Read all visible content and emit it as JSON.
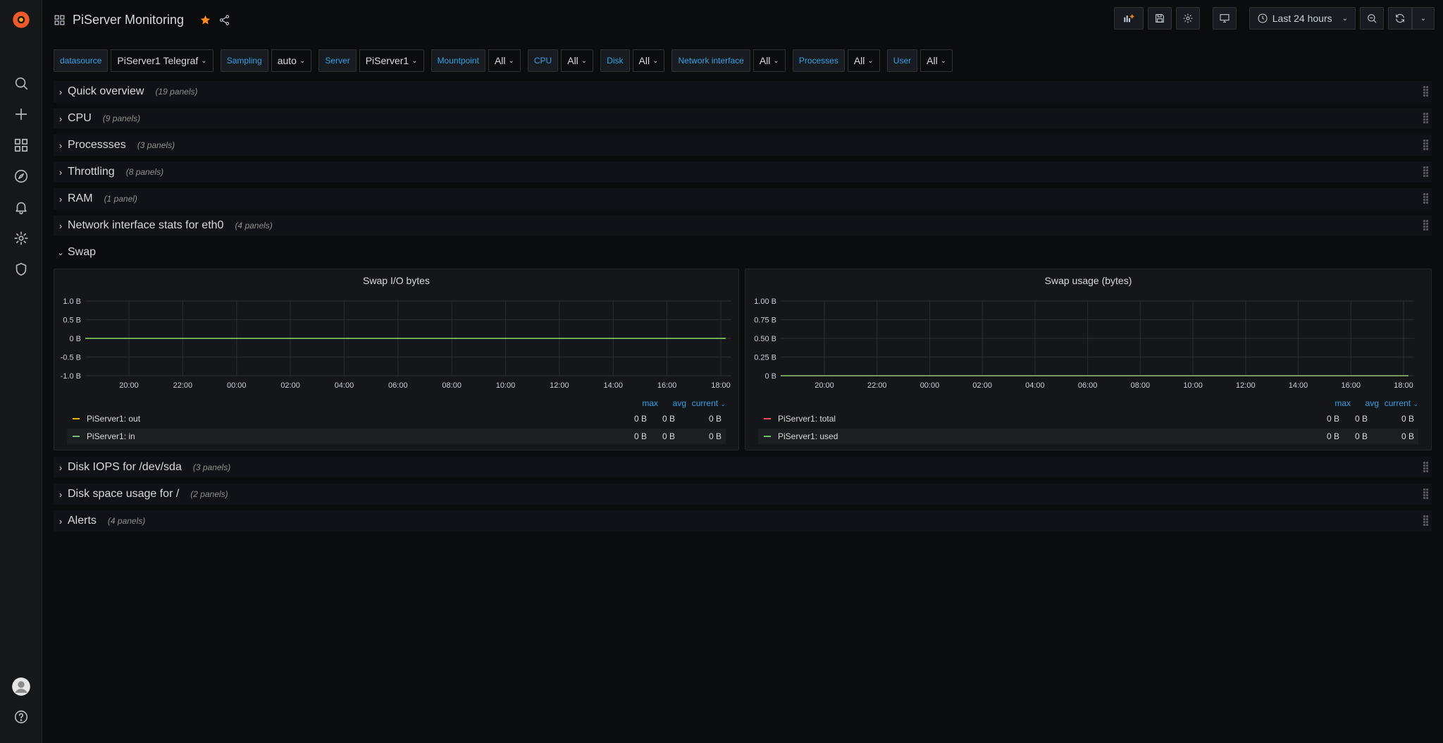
{
  "app": {
    "title": "PiServer Monitoring"
  },
  "toolbar": {
    "time_range": "Last 24 hours"
  },
  "variables": [
    {
      "label": "datasource",
      "value": "PiServer1 Telegraf"
    },
    {
      "label": "Sampling",
      "value": "auto"
    },
    {
      "label": "Server",
      "value": "PiServer1"
    },
    {
      "label": "Mountpoint",
      "value": "All"
    },
    {
      "label": "CPU",
      "value": "All"
    },
    {
      "label": "Disk",
      "value": "All"
    },
    {
      "label": "Network interface",
      "value": "All"
    },
    {
      "label": "Processes",
      "value": "All"
    },
    {
      "label": "User",
      "value": "All"
    }
  ],
  "rows": [
    {
      "title": "Quick overview",
      "count": "(19 panels)"
    },
    {
      "title": "CPU",
      "count": "(9 panels)"
    },
    {
      "title": "Processses",
      "count": "(3 panels)"
    },
    {
      "title": "Throttling",
      "count": "(8 panels)"
    },
    {
      "title": "RAM",
      "count": "(1 panel)"
    },
    {
      "title": "Network interface stats for eth0",
      "count": "(4 panels)"
    },
    {
      "title": "Swap",
      "count": ""
    },
    {
      "title": "Disk IOPS for /dev/sda",
      "count": "(3 panels)"
    },
    {
      "title": "Disk space usage for /",
      "count": "(2 panels)"
    },
    {
      "title": "Alerts",
      "count": "(4 panels)"
    }
  ],
  "legend_headers": {
    "max": "max",
    "avg": "avg",
    "current": "current"
  },
  "colors": {
    "accent": "#33a2e5",
    "yellow": "#e0b400",
    "green": "#73bf69",
    "red": "#f2495c",
    "star": "#ff8a1f"
  },
  "chart_data": [
    {
      "type": "line",
      "title": "Swap I/O bytes",
      "x": [
        "20:00",
        "22:00",
        "00:00",
        "02:00",
        "04:00",
        "06:00",
        "08:00",
        "10:00",
        "12:00",
        "14:00",
        "16:00",
        "18:00"
      ],
      "y_ticks": [
        "1.0 B",
        "0.5 B",
        "0 B",
        "-0.5 B",
        "-1.0 B"
      ],
      "ylim": [
        -1,
        1
      ],
      "series": [
        {
          "name": "PiServer1: out",
          "color": "#e0b400",
          "values": [
            0,
            0,
            0,
            0,
            0,
            0,
            0,
            0,
            0,
            0,
            0,
            0
          ],
          "max": "0 B",
          "avg": "0 B",
          "current": "0 B"
        },
        {
          "name": "PiServer1: in",
          "color": "#73bf69",
          "values": [
            0,
            0,
            0,
            0,
            0,
            0,
            0,
            0,
            0,
            0,
            0,
            0
          ],
          "max": "0 B",
          "avg": "0 B",
          "current": "0 B"
        }
      ]
    },
    {
      "type": "line",
      "title": "Swap usage (bytes)",
      "x": [
        "20:00",
        "22:00",
        "00:00",
        "02:00",
        "04:00",
        "06:00",
        "08:00",
        "10:00",
        "12:00",
        "14:00",
        "16:00",
        "18:00"
      ],
      "y_ticks": [
        "1.00 B",
        "0.75 B",
        "0.50 B",
        "0.25 B",
        "0 B"
      ],
      "ylim": [
        0,
        1
      ],
      "series": [
        {
          "name": "PiServer1: total",
          "color": "#f2495c",
          "values": [
            0,
            0,
            0,
            0,
            0,
            0,
            0,
            0,
            0,
            0,
            0,
            0
          ],
          "max": "0 B",
          "avg": "0 B",
          "current": "0 B"
        },
        {
          "name": "PiServer1: used",
          "color": "#73bf69",
          "values": [
            0,
            0,
            0,
            0,
            0,
            0,
            0,
            0,
            0,
            0,
            0,
            0
          ],
          "max": "0 B",
          "avg": "0 B",
          "current": "0 B"
        }
      ]
    }
  ]
}
